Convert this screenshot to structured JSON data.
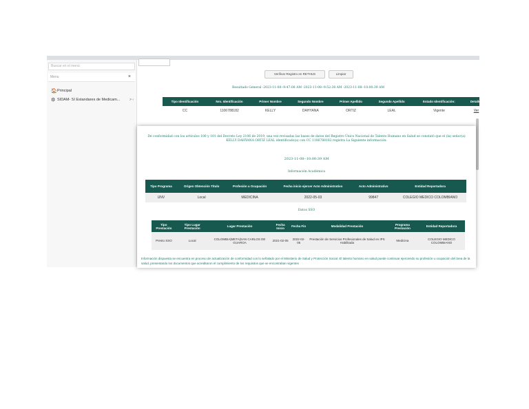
{
  "sidebar": {
    "search_placeholder": "Buscar en el menú",
    "menu_filter": "Menu",
    "close_glyph": "×",
    "items": [
      {
        "label": "Principal",
        "icon": "home-icon",
        "glyph": "🏠"
      },
      {
        "label": "SIDAM- SI Estandares de Medicam...",
        "icon": "cogs-icon",
        "glyph": "⚙",
        "chevron": "> ‹"
      }
    ]
  },
  "toolbar": {
    "verify_label": "Verificar Registro en RETHUS",
    "clear_label": "Limpiar"
  },
  "result": {
    "line": "Resultado General -2023-11-08--9:47:08 AM -2023-11-08--9:52:38 AM -2023-11-08--10:00:39 AM"
  },
  "person_table": {
    "headers": [
      "Tipo Identificación",
      "Nro. Identificación",
      "Primer Nombre",
      "Segundo Nombre",
      "Primer Apellido",
      "Segundo Apellido",
      "Estado Identificación:",
      "Detalles"
    ],
    "row": [
      "CC",
      "1106788182",
      "KELLY",
      "DAHYANA",
      "ORTIZ",
      "LEAL",
      "Vigente",
      "Ver"
    ]
  },
  "modal": {
    "intro": "De conformidad con los artículos 100 y 101 del Decreto Ley 2106 de 2019, una vez revisadas las bases de datos del Registro Único Nacional de Talento Humano en Salud se constató que el (la) señor(a) KELLY DAHYANA ORTIZ LEAL identificado(a) con CC 1106788182 registra La Siguiente información:",
    "timestamp": "2023-11-08--10:00:39 AM",
    "academic_title": "Información Académica",
    "academic_headers": [
      "Tipo Programa",
      "Origen Obtención Título",
      "Profesión u Ocupación",
      "Fecha inicio ejercer Acto Administrativo",
      "Acto Administrativo",
      "Entidad Reportadora"
    ],
    "academic_row": [
      "UNV",
      "Local",
      "MEDICINA",
      "2022-05-03",
      "99847",
      "COLEGIO MEDICO COLOMBIANO"
    ],
    "sso_title": "Datos SSO",
    "sso_headers": [
      "Tipo Prestación",
      "Tipo Lugar Prestación",
      "Lugar Prestación",
      "Fecha Inicio",
      "Fecha Fin",
      "Modalidad Prestación",
      "Programa Prestación",
      "Entidad Reportadora"
    ],
    "sso_row": [
      "Presto SSO",
      "Local",
      "COLOMBIA|META|SAN CARLOS DE GUAROA",
      "2021-02-05",
      "2022-02-05",
      "Prestación de Servicios Profesionales de Salud en IPS Habilitada",
      "Medicina",
      "COLEGIO MEDICO COLOMBIANO"
    ],
    "footnote": "Información dispuesta se encuentra en proceso de actualización de conformidad con lo señalado por el Ministerio de Salud y Protección Social. El talento humano en salud puede continuar ejerciendo su profesión u ocupación del área de la salud, presentando los documentos que acreditaron el cumplimiento de los requisitos que se encontraban vigentes"
  }
}
